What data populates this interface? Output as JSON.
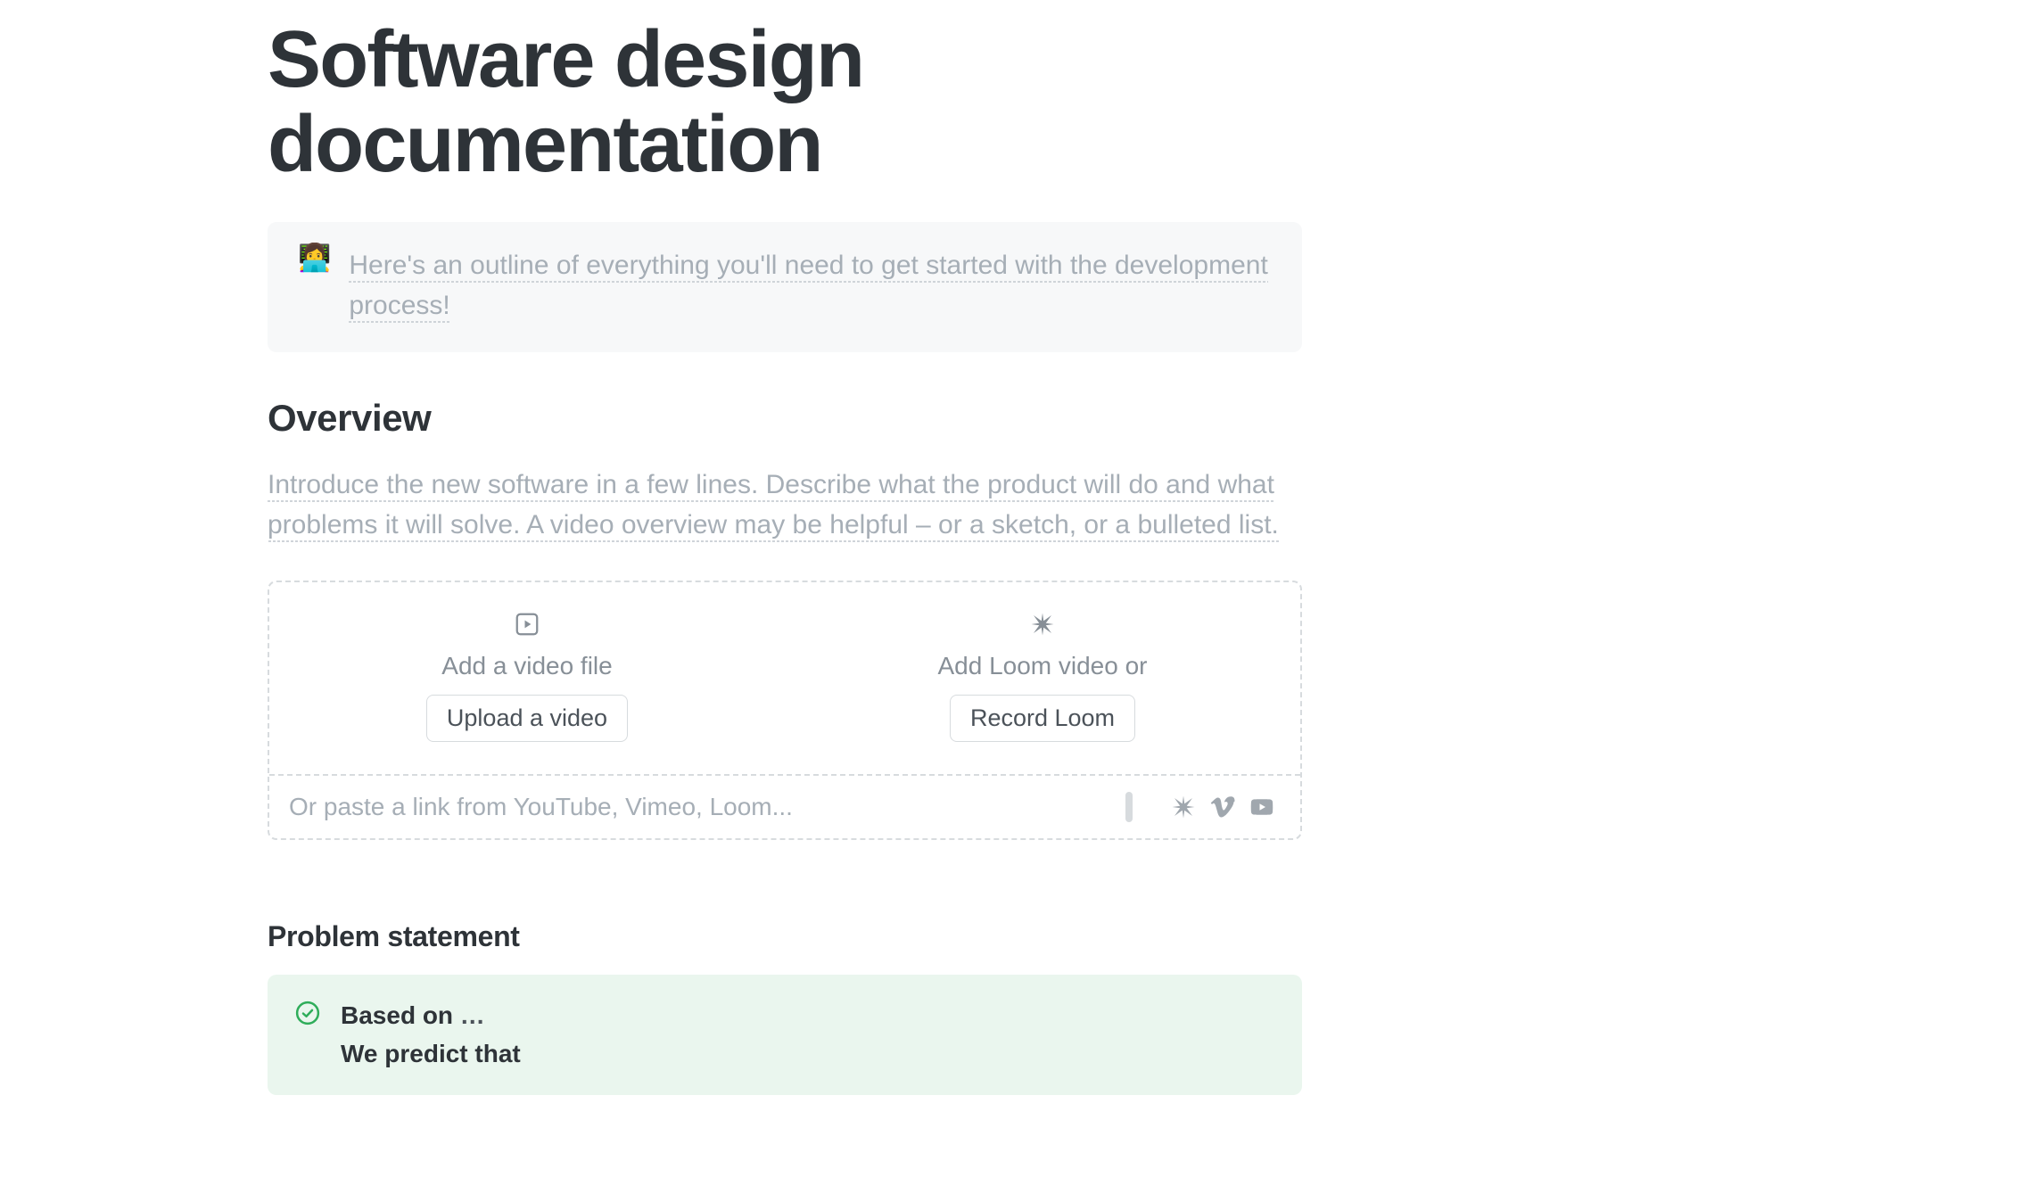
{
  "title": "Software design documentation",
  "callout": {
    "icon": "👩‍💻",
    "text": "Here's an outline of everything you'll need to get started with the development process!"
  },
  "overview": {
    "heading": "Overview",
    "placeholder": "Introduce the new software in a few lines. Describe what the product will do and what problems it will solve. A video overview may be helpful – or a sketch, or a bulleted list."
  },
  "video": {
    "file_label": "Add a video file",
    "file_button": "Upload a video",
    "loom_label": "Add Loom video or",
    "loom_button": "Record Loom",
    "link_placeholder": "Or paste a link from YouTube, Vimeo, Loom..."
  },
  "problem": {
    "heading": "Problem statement",
    "line1_prefix": "Based on",
    "line1_suffix": " …",
    "line2": "We predict that"
  }
}
